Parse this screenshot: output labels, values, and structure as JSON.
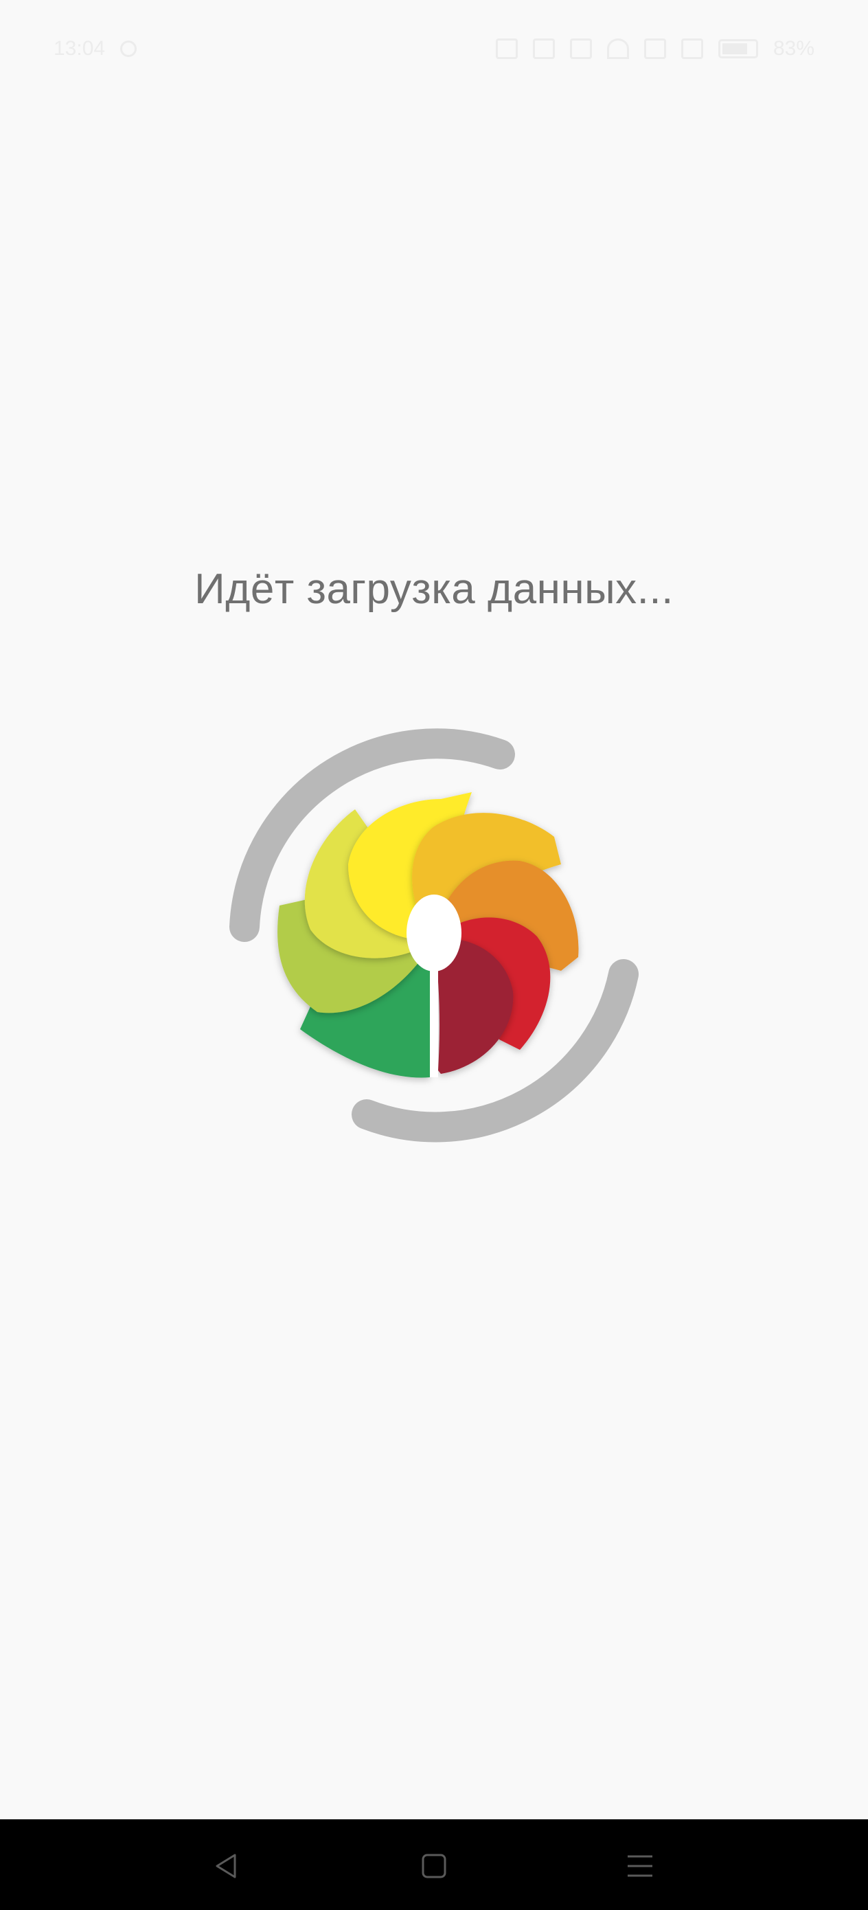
{
  "status_bar": {
    "time": "13:04",
    "battery_percent": "83%"
  },
  "loading": {
    "message": "Идёт загрузка данных..."
  },
  "colors": {
    "background": "#f9f9f9",
    "text": "#707070",
    "spinner_arc": "#b8b8b8",
    "nav_bar": "#000000",
    "petal_dark_green": "#2ea55a",
    "petal_light_green": "#b2cc4a",
    "petal_lime": "#e2e24a",
    "petal_yellow": "#ffeb2a",
    "petal_gold": "#f2bf2a",
    "petal_orange": "#e68f2a",
    "petal_red": "#d3232f",
    "petal_maroon": "#9c2136",
    "spoon": "#ffffff"
  },
  "icons": {
    "back": "triangle-back-icon",
    "home": "square-home-icon",
    "menu": "three-lines-menu-icon"
  }
}
